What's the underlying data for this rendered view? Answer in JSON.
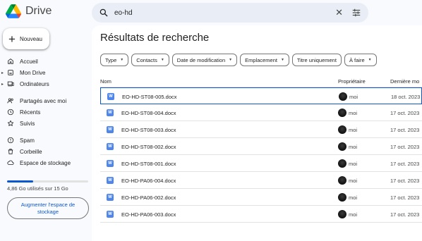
{
  "app": {
    "name": "Drive"
  },
  "search": {
    "query": "eo-hd",
    "icon": "search-icon",
    "clear_glyph": "✕",
    "tune_icon": "tune-icon"
  },
  "new_button": {
    "label": "Nouveau"
  },
  "sidebar": {
    "items": [
      {
        "label": "Accueil",
        "icon": "home-icon",
        "caret": false
      },
      {
        "label": "Mon Drive",
        "icon": "drive-icon",
        "caret": true
      },
      {
        "label": "Ordinateurs",
        "icon": "computer-icon",
        "caret": true
      },
      {
        "label": "Partagés avec moi",
        "icon": "people-icon",
        "caret": false
      },
      {
        "label": "Récents",
        "icon": "clock-icon",
        "caret": false
      },
      {
        "label": "Suivis",
        "icon": "star-icon",
        "caret": false
      },
      {
        "label": "Spam",
        "icon": "spam-icon",
        "caret": false
      },
      {
        "label": "Corbeille",
        "icon": "trash-icon",
        "caret": false
      },
      {
        "label": "Espace de stockage",
        "icon": "cloud-icon",
        "caret": false
      }
    ],
    "storage_text": "4,86 Go utilisés sur 15 Go",
    "storage_fraction": 0.324,
    "upgrade_label": "Augmenter l'espace de stockage"
  },
  "main": {
    "title": "Résultats de recherche",
    "filters": [
      {
        "label": "Type",
        "dropdown": true
      },
      {
        "label": "Contacts",
        "dropdown": true
      },
      {
        "label": "Date de modification",
        "dropdown": true
      },
      {
        "label": "Emplacement",
        "dropdown": true
      },
      {
        "label": "Titre uniquement",
        "dropdown": false
      },
      {
        "label": "À faire",
        "dropdown": true
      }
    ],
    "columns": {
      "name": "Nom",
      "owner": "Propriétaire",
      "modified": "Dernière mo"
    },
    "rows": [
      {
        "name": "EO-HD-ST08-005.docx",
        "owner": "moi",
        "date": "18 oct. 2023"
      },
      {
        "name": "EO-HD-ST08-004.docx",
        "owner": "moi",
        "date": "17 oct. 2023"
      },
      {
        "name": "EO-HD-ST08-003.docx",
        "owner": "moi",
        "date": "17 oct. 2023"
      },
      {
        "name": "EO-HD-ST08-002.docx",
        "owner": "moi",
        "date": "17 oct. 2023"
      },
      {
        "name": "EO-HD-ST08-001.docx",
        "owner": "moi",
        "date": "17 oct. 2023"
      },
      {
        "name": "EO-HD-PA06-004.docx",
        "owner": "moi",
        "date": "17 oct. 2023"
      },
      {
        "name": "EO-HD-PA06-002.docx",
        "owner": "moi",
        "date": "17 oct. 2023"
      },
      {
        "name": "EO-HD-PA06-003.docx",
        "owner": "moi",
        "date": "17 oct. 2023"
      }
    ],
    "selected_row": 0,
    "file_icon_letter": "W"
  },
  "colors": {
    "accent": "#0b57d0",
    "docx": "#4f86ec",
    "background": "#f8fafd",
    "search_bg": "#e9eef6"
  }
}
